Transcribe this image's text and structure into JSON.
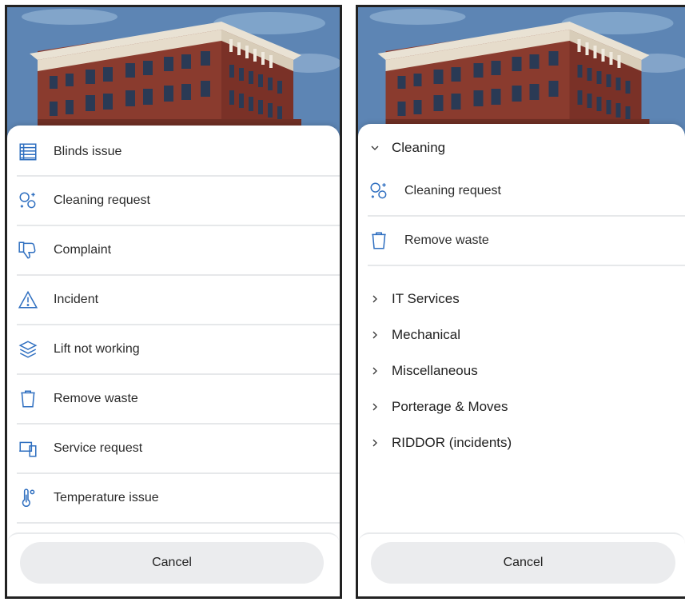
{
  "left_panel": {
    "menu_items": [
      {
        "label": "Blinds issue",
        "icon": "blinds-icon"
      },
      {
        "label": "Cleaning request",
        "icon": "cleaning-bubbles-icon"
      },
      {
        "label": "Complaint",
        "icon": "thumbs-down-icon"
      },
      {
        "label": "Incident",
        "icon": "warning-triangle-icon"
      },
      {
        "label": "Lift not working",
        "icon": "layers-icon"
      },
      {
        "label": "Remove waste",
        "icon": "trash-bin-icon"
      },
      {
        "label": "Service request",
        "icon": "devices-icon"
      },
      {
        "label": "Temperature issue",
        "icon": "thermometer-icon"
      }
    ],
    "cancel_label": "Cancel"
  },
  "right_panel": {
    "expanded_group": {
      "label": "Cleaning",
      "items": [
        {
          "label": "Cleaning request",
          "icon": "cleaning-bubbles-icon"
        },
        {
          "label": "Remove waste",
          "icon": "trash-bin-icon"
        }
      ]
    },
    "collapsed_groups": [
      {
        "label": "IT Services"
      },
      {
        "label": "Mechanical"
      },
      {
        "label": "Miscellaneous"
      },
      {
        "label": "Porterage & Moves"
      },
      {
        "label": "RIDDOR (incidents)"
      }
    ],
    "cancel_label": "Cancel"
  },
  "colors": {
    "icon_blue": "#2f6fc0",
    "divider": "#e6e8ea",
    "button_bg": "#ebecee",
    "sky": "#5d85b4",
    "brick": "#8a3b2e"
  }
}
